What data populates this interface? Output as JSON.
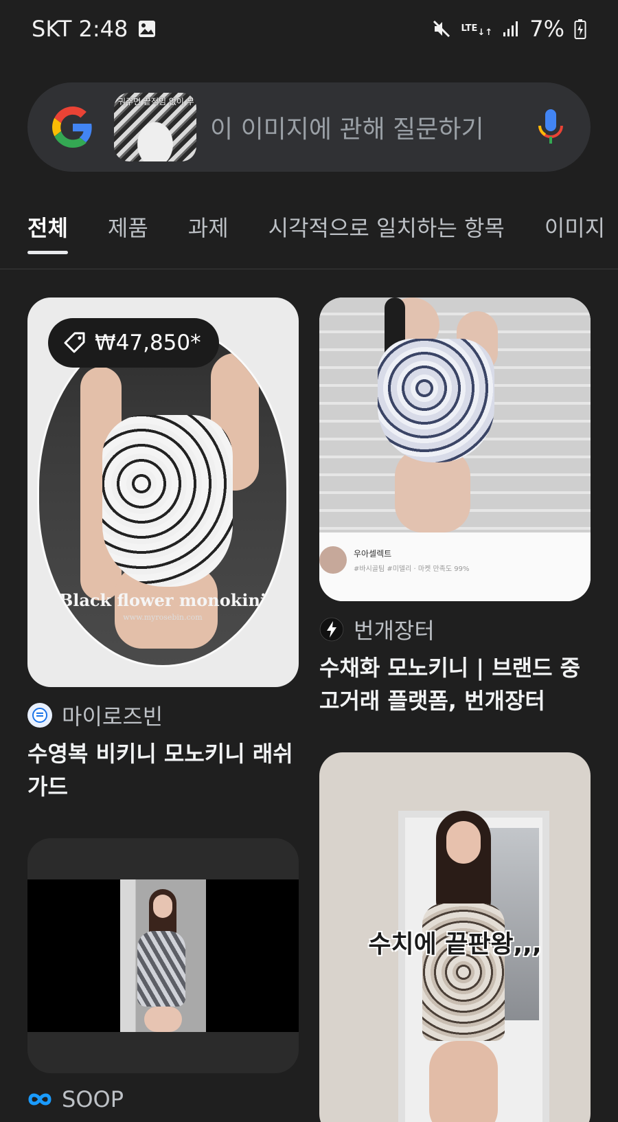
{
  "status_bar": {
    "carrier_time": "SKT 2:48",
    "network": "LTE",
    "battery": "7%"
  },
  "search": {
    "placeholder": "이 이미지에 관해 질문하기",
    "thumbnail_text": "궈주면 끝적임 없이 무"
  },
  "tabs": [
    {
      "label": "전체",
      "active": true
    },
    {
      "label": "제품",
      "active": false
    },
    {
      "label": "과제",
      "active": false
    },
    {
      "label": "시각적으로 일치하는 항목",
      "active": false
    },
    {
      "label": "이미지",
      "active": false
    }
  ],
  "results": [
    {
      "price": "₩47,850*",
      "image_caption": "Black flower monokini",
      "image_url_text": "www.myrosebin.com",
      "source": "마이로즈빈",
      "title": "수영복 비키니 모노키니 래쉬가드"
    },
    {
      "shop_name": "우아셀렉트",
      "shop_tags": "#바시골팀 #미델리 · 마켓 만족도 99%",
      "source": "번개장터",
      "title": "수채화 모노키니 | 브랜드 중고거래 플랫폼, 번개장터"
    },
    {
      "source": "SOOP"
    },
    {
      "image_caption": "수치에 끝판왕,,,"
    }
  ],
  "colors": {
    "background": "#1f1f1f",
    "search_bg": "#303134",
    "text_primary": "#f1f3f4",
    "text_secondary": "#bdc1c6"
  }
}
